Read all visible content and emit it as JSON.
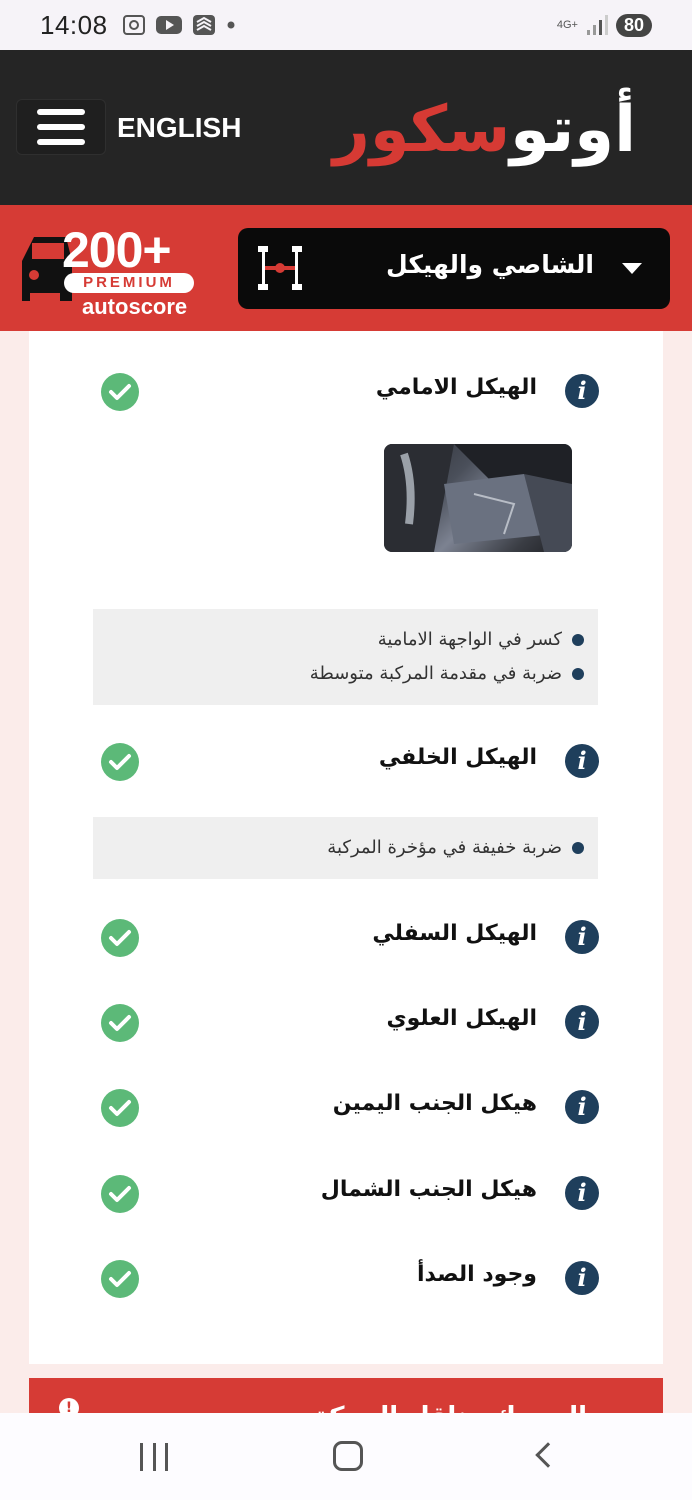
{
  "status_bar": {
    "time": "14:08",
    "network": "4G+",
    "battery": "80"
  },
  "header": {
    "language_button": "ENGLISH",
    "logo_part1": "أوتو",
    "logo_part2": "سكور"
  },
  "badge": {
    "number": "200+",
    "tier": "PREMIUM",
    "brand_a": "auto",
    "brand_b": "score"
  },
  "section_selector": {
    "label": "الشاصي والهيكل"
  },
  "items": [
    {
      "label": "الهيكل الامامي",
      "status": "ok"
    },
    {
      "label": "الهيكل الخلفي",
      "status": "ok"
    },
    {
      "label": "الهيكل السفلي",
      "status": "ok"
    },
    {
      "label": "الهيكل العلوي",
      "status": "ok"
    },
    {
      "label": "هيكل الجنب اليمين",
      "status": "ok"
    },
    {
      "label": "هيكل الجنب الشمال",
      "status": "ok"
    },
    {
      "label": "وجود الصدأ",
      "status": "ok"
    }
  ],
  "notes": {
    "front": [
      "كسر في الواجهة الامامية",
      "ضربة في مقدمة المركبة متوسطة"
    ],
    "rear": [
      "ضربة خفيفة في مؤخرة المركبة"
    ]
  },
  "next_section": {
    "label": "المحرك وناقل الحركة"
  },
  "colors": {
    "brand_red": "#d63b35",
    "header_dark": "#252525",
    "check_green": "#5cb978",
    "info_navy": "#1f3f5c"
  }
}
